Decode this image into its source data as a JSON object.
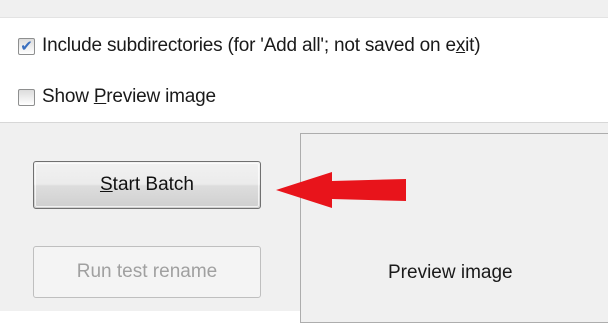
{
  "options": {
    "include_subdirectories": {
      "label_before": "Include subdirectories (for 'Add all'; not saved on e",
      "mnemonic": "x",
      "label_after": "it)",
      "checked": true
    },
    "show_preview": {
      "label_before": "Show ",
      "mnemonic": "P",
      "label_after": "review image",
      "checked": false
    }
  },
  "buttons": {
    "start_batch": {
      "mnemonic": "S",
      "label_rest": "tart Batch",
      "enabled": true
    },
    "run_test_rename": {
      "label": "Run test rename",
      "enabled": false
    }
  },
  "preview": {
    "placeholder": "Preview image"
  },
  "annotation": {
    "arrow_color": "#e8141b",
    "points_to": "start_batch"
  },
  "colors": {
    "checkmark": "#3a6fbf",
    "panel": "#f0f0f0"
  }
}
